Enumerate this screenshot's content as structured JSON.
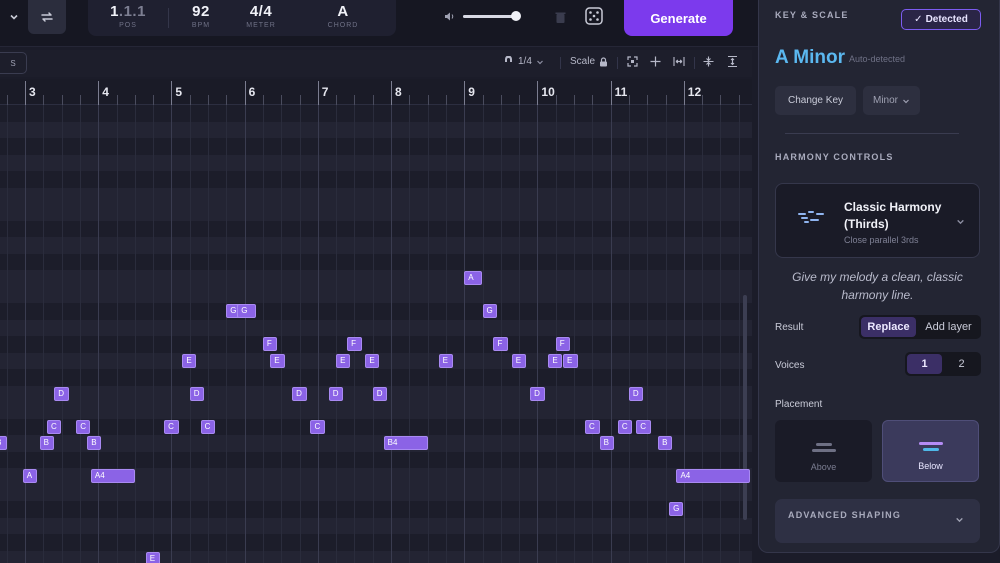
{
  "transport": {
    "pos": {
      "bar": "1",
      "rest": ".1.1",
      "label": "POS"
    },
    "bpm": {
      "value": "92",
      "label": "BPM"
    },
    "meter": {
      "value": "4/4",
      "label": "METER"
    },
    "chord": {
      "value": "A",
      "label": "CHORD"
    },
    "volume_level": 0.95,
    "generate_label": "Generate"
  },
  "toolbar": {
    "side_tab": "S",
    "grid_value": "1/4",
    "scale_label": "Scale"
  },
  "ruler": {
    "bars": [
      "3",
      "4",
      "5",
      "6",
      "7",
      "8",
      "9",
      "10",
      "11",
      "12"
    ]
  },
  "notes": [
    {
      "label": "A",
      "start": 9.0,
      "length": 0.25,
      "row": 10
    },
    {
      "label": "G",
      "start": 5.75,
      "length": 0.1,
      "row": 12
    },
    {
      "label": "G",
      "start": 5.9,
      "length": 0.25,
      "row": 12
    },
    {
      "label": "G",
      "start": 9.25,
      "length": 0.08,
      "row": 12
    },
    {
      "label": "F",
      "start": 6.25,
      "length": 0.08,
      "row": 14
    },
    {
      "label": "F",
      "start": 7.4,
      "length": 0.2,
      "row": 14
    },
    {
      "label": "F",
      "start": 9.4,
      "length": 0.2,
      "row": 14
    },
    {
      "label": "F",
      "start": 10.25,
      "length": 0.08,
      "row": 14
    },
    {
      "label": "E",
      "start": 5.15,
      "length": 0.08,
      "row": 15
    },
    {
      "label": "E",
      "start": 6.35,
      "length": 0.2,
      "row": 15
    },
    {
      "label": "E",
      "start": 7.25,
      "length": 0.08,
      "row": 15
    },
    {
      "label": "E",
      "start": 7.65,
      "length": 0.08,
      "row": 15
    },
    {
      "label": "E",
      "start": 8.65,
      "length": 0.2,
      "row": 15
    },
    {
      "label": "E",
      "start": 9.65,
      "length": 0.2,
      "row": 15
    },
    {
      "label": "E",
      "start": 10.15,
      "length": 0.08,
      "row": 15
    },
    {
      "label": "E",
      "start": 10.35,
      "length": 0.2,
      "row": 15
    },
    {
      "label": "D",
      "start": 3.4,
      "length": 0.2,
      "row": 17
    },
    {
      "label": "D",
      "start": 5.25,
      "length": 0.08,
      "row": 17
    },
    {
      "label": "D",
      "start": 6.65,
      "length": 0.2,
      "row": 17
    },
    {
      "label": "D",
      "start": 7.15,
      "length": 0.08,
      "row": 17
    },
    {
      "label": "D",
      "start": 7.75,
      "length": 0.08,
      "row": 17
    },
    {
      "label": "D",
      "start": 9.9,
      "length": 0.2,
      "row": 17
    },
    {
      "label": "D",
      "start": 11.25,
      "length": 0.08,
      "row": 17
    },
    {
      "label": "C",
      "start": 3.3,
      "length": 0.08,
      "row": 19
    },
    {
      "label": "C",
      "start": 3.7,
      "length": 0.08,
      "row": 19
    },
    {
      "label": "C",
      "start": 4.9,
      "length": 0.2,
      "row": 19
    },
    {
      "label": "C",
      "start": 5.4,
      "length": 0.2,
      "row": 19
    },
    {
      "label": "C",
      "start": 6.9,
      "length": 0.2,
      "row": 19
    },
    {
      "label": "C",
      "start": 10.65,
      "length": 0.2,
      "row": 19
    },
    {
      "label": "C",
      "start": 11.1,
      "length": 0.08,
      "row": 19
    },
    {
      "label": "C",
      "start": 11.35,
      "length": 0.2,
      "row": 19
    },
    {
      "label": "B",
      "start": 2.55,
      "length": 0.2,
      "row": 20
    },
    {
      "label": "B",
      "start": 3.2,
      "length": 0.08,
      "row": 20
    },
    {
      "label": "B",
      "start": 3.85,
      "length": 0.08,
      "row": 20
    },
    {
      "label": "B4",
      "start": 7.9,
      "length": 0.6,
      "row": 20
    },
    {
      "label": "B",
      "start": 10.85,
      "length": 0.2,
      "row": 20
    },
    {
      "label": "B",
      "start": 11.65,
      "length": 0.08,
      "row": 20
    },
    {
      "label": "A",
      "start": 2.97,
      "length": 0.2,
      "row": 22
    },
    {
      "label": "A4",
      "start": 3.9,
      "length": 0.6,
      "row": 22
    },
    {
      "label": "A4",
      "start": 11.9,
      "length": 1.0,
      "row": 22
    },
    {
      "label": "G",
      "start": 11.8,
      "length": 0.08,
      "row": 24
    },
    {
      "label": "E",
      "start": 4.65,
      "length": 0.2,
      "row": 27
    }
  ],
  "panel": {
    "key_scale_title": "KEY & SCALE",
    "detected_label": "Detected",
    "key_name": "A Minor",
    "auto_detected": "Auto-detected",
    "change_key_label": "Change Key",
    "scale_mode": "Minor",
    "harmony_title": "HARMONY CONTROLS",
    "harmony_name": "Classic Harmony (Thirds)",
    "harmony_desc": "Close parallel 3rds",
    "harmony_quote": "Give my melody a clean, classic harmony line.",
    "result_label": "Result",
    "result_options": [
      "Replace",
      "Add layer"
    ],
    "voices_label": "Voices",
    "voices_options": [
      "1",
      "2"
    ],
    "placement_label": "Placement",
    "placement_above": "Above",
    "placement_below": "Below",
    "advanced_label": "ADVANCED SHAPING"
  },
  "colors": {
    "accent": "#7c3aed",
    "key": "#5bb8f0",
    "note": "#8b63e6"
  }
}
